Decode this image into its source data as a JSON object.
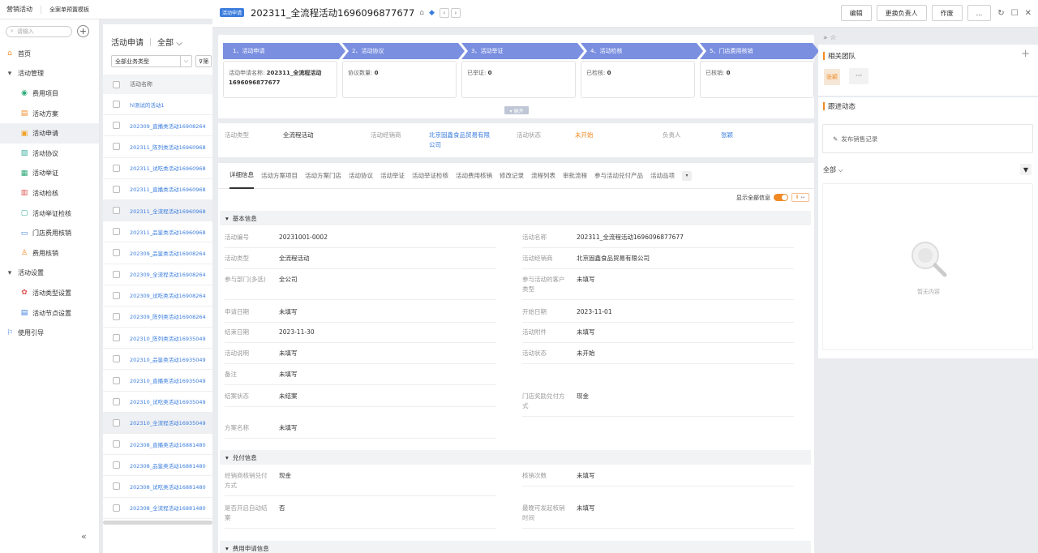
{
  "topbar": {
    "brand": "营销活动",
    "template": "全案单预置模板"
  },
  "sidebar": {
    "search_placeholder": "请输入",
    "items": [
      {
        "label": "首页",
        "level": 1,
        "icon": "home-icon"
      },
      {
        "label": "活动管理",
        "level": 1,
        "icon": "caret-down-icon"
      },
      {
        "label": "费用项目",
        "level": 2,
        "icon": "coin-icon"
      },
      {
        "label": "活动方案",
        "level": 2,
        "icon": "plan-icon"
      },
      {
        "label": "活动申请",
        "level": 2,
        "icon": "apply-icon",
        "active": true
      },
      {
        "label": "活动协议",
        "level": 2,
        "icon": "agreement-icon"
      },
      {
        "label": "活动举证",
        "level": 2,
        "icon": "proof-icon"
      },
      {
        "label": "活动检核",
        "level": 2,
        "icon": "check-icon"
      },
      {
        "label": "活动举证检核",
        "level": 2,
        "icon": "proof-check-icon"
      },
      {
        "label": "门店费用核销",
        "level": 2,
        "icon": "store-icon"
      },
      {
        "label": "费用核销",
        "level": 2,
        "icon": "writeoff-icon"
      },
      {
        "label": "活动设置",
        "level": 1,
        "icon": "caret-down-icon"
      },
      {
        "label": "活动类型设置",
        "level": 2,
        "icon": "type-icon"
      },
      {
        "label": "活动节点设置",
        "level": 2,
        "icon": "node-icon"
      },
      {
        "label": "使用引导",
        "level": 1,
        "icon": "flag-icon"
      }
    ]
  },
  "list": {
    "title": "活动申请",
    "scope": "全部",
    "filter_select": "全部业务类型",
    "filter_button": "筛",
    "header": "活动名称",
    "rows": [
      "hl测试的活动1",
      "202309_直播类活动16908264",
      "202311_陈列类活动16960968",
      "202311_试吃类活动16960968",
      "202311_直播类活动16960968",
      "202311_全流程活动16960968",
      "202311_品鉴类活动16960968",
      "202309_品鉴类活动16908264",
      "202309_全流程活动16908264",
      "202309_试吃类活动16908264",
      "202309_陈列类活动16908264",
      "202310_陈列类活动16935049",
      "202310_品鉴类活动16935049",
      "202310_直播类活动16935049",
      "202310_试吃类活动16935049",
      "202310_全流程活动16935049",
      "202308_直播类活动16881480",
      "202308_品鉴类活动16881480",
      "202308_试吃类活动16881480",
      "202308_全流程活动16881480"
    ]
  },
  "detail": {
    "tag": "活动申请",
    "title": "202311_全流程活动1696096877677",
    "buttons": {
      "edit": "编辑",
      "change_owner": "更换负责人",
      "void": "作废",
      "more": "..."
    },
    "stages": [
      {
        "label": "1、活动申请",
        "card": "活动申请名称: ",
        "value": "202311_全流程活动1696096877677"
      },
      {
        "label": "2、活动协议",
        "card": "协议数量: ",
        "value": "0"
      },
      {
        "label": "3、活动举证",
        "card": "已举证: ",
        "value": "0"
      },
      {
        "label": "4、活动检核",
        "card": "已检核: ",
        "value": "0"
      },
      {
        "label": "5、门店费用核销",
        "card": "已核销: ",
        "value": "0"
      }
    ],
    "expand": "▾ 展开",
    "summary": {
      "type_label": "活动类型",
      "type_value": "全流程活动",
      "dealer_label": "活动经销商",
      "dealer_value": "北京固鑫食品贸易有限公司",
      "status_label": "活动状态",
      "status_value": "未开始",
      "owner_label": "负责人",
      "owner_value": "张颖"
    },
    "tabs": [
      "详细信息",
      "活动方案项目",
      "活动方案门店",
      "活动协议",
      "活动举证",
      "活动举证检核",
      "活动费用核销",
      "修改记录",
      "流程列表",
      "审批流程",
      "参与活动兑付产品",
      "活动品项"
    ],
    "show_all": "显示全部信息",
    "sections": {
      "basic": "基本信息",
      "payment": "兑付信息",
      "fee": "费用申请信息"
    },
    "basic_fields": {
      "code_label": "活动编号",
      "code_value": "20231001-0002",
      "name_label": "活动名称",
      "name_value": "202311_全流程活动1696096877677",
      "type_label": "活动类型",
      "type_value": "全流程活动",
      "dealer_label": "活动经销商",
      "dealer_value": "北京固鑫食品贸易有限公司",
      "dept_label": "参与部门(多选)",
      "dept_value": "全公司",
      "custtype_label": "参与活动的客户类型",
      "custtype_value": "未填写",
      "applydate_label": "申请日期",
      "applydate_value": "未填写",
      "start_label": "开始日期",
      "start_value": "2023-11-01",
      "end_label": "结束日期",
      "end_value": "2023-11-30",
      "attach_label": "活动附件",
      "attach_value": "未填写",
      "desc_label": "活动说明",
      "desc_value": "未填写",
      "status_label": "活动状态",
      "status_value": "未开始",
      "remark_label": "备注",
      "remark_value": "未填写",
      "close_label": "结案状态",
      "close_value": "未结案",
      "reward_label": "门店奖励兑付方式",
      "reward_value": "现金",
      "plan_label": "方案名称",
      "plan_value": "未填写"
    },
    "payment_fields": {
      "method_label": "经销商核销兑付方式",
      "method_value": "现金",
      "count_label": "核销次数",
      "count_value": "未填写",
      "auto_label": "是否开启自动结案",
      "auto_value": "否",
      "latest_label": "最晚可发起核销时间",
      "latest_value": "未填写"
    }
  },
  "right": {
    "team_title": "相关团队",
    "member": "张颖",
    "more": "···",
    "dynamic_title": "跟进动态",
    "post": "发布销售记录",
    "scope": "全部",
    "empty": "暂无内容"
  }
}
